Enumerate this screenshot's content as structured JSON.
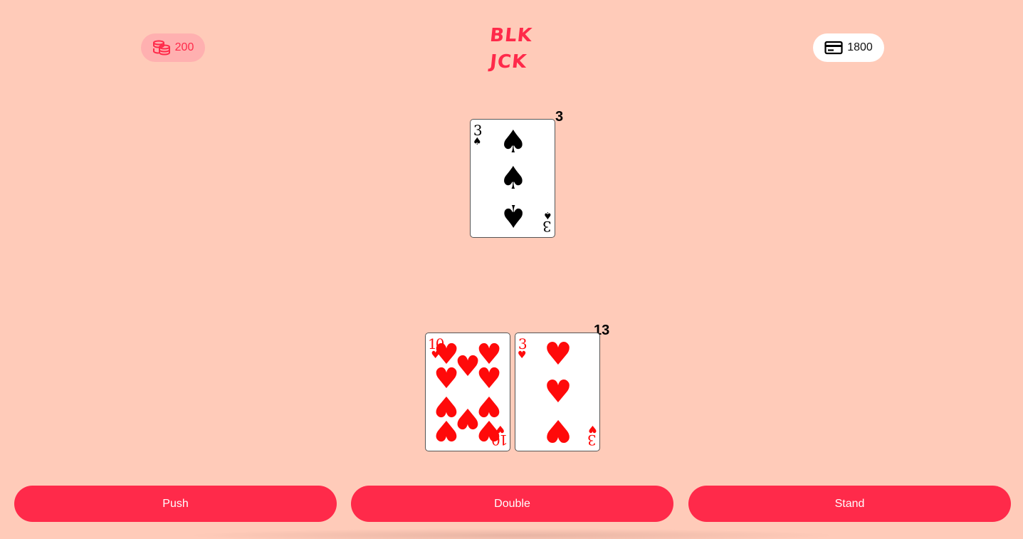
{
  "header": {
    "bet": {
      "icon": "coins-icon",
      "amount": "200"
    },
    "logo": {
      "line1": "BLK",
      "line2": "JCK"
    },
    "bank": {
      "icon": "credit-card-icon",
      "amount": "1800"
    }
  },
  "dealer": {
    "score": "3",
    "cards": [
      {
        "rank": "3",
        "suit": "spades",
        "suit_symbol": "♠"
      }
    ]
  },
  "player": {
    "score": "13",
    "cards": [
      {
        "rank": "10",
        "suit": "hearts",
        "suit_symbol": "♥"
      },
      {
        "rank": "3",
        "suit": "hearts",
        "suit_symbol": "♥"
      }
    ]
  },
  "actions": {
    "push_label": "Push",
    "double_label": "Double",
    "stand_label": "Stand"
  },
  "colors": {
    "background": "#ffcbb9",
    "accent": "#ff2a4a",
    "bet_pill": "#ffb0b0",
    "red_suit": "#ff0a0a"
  }
}
